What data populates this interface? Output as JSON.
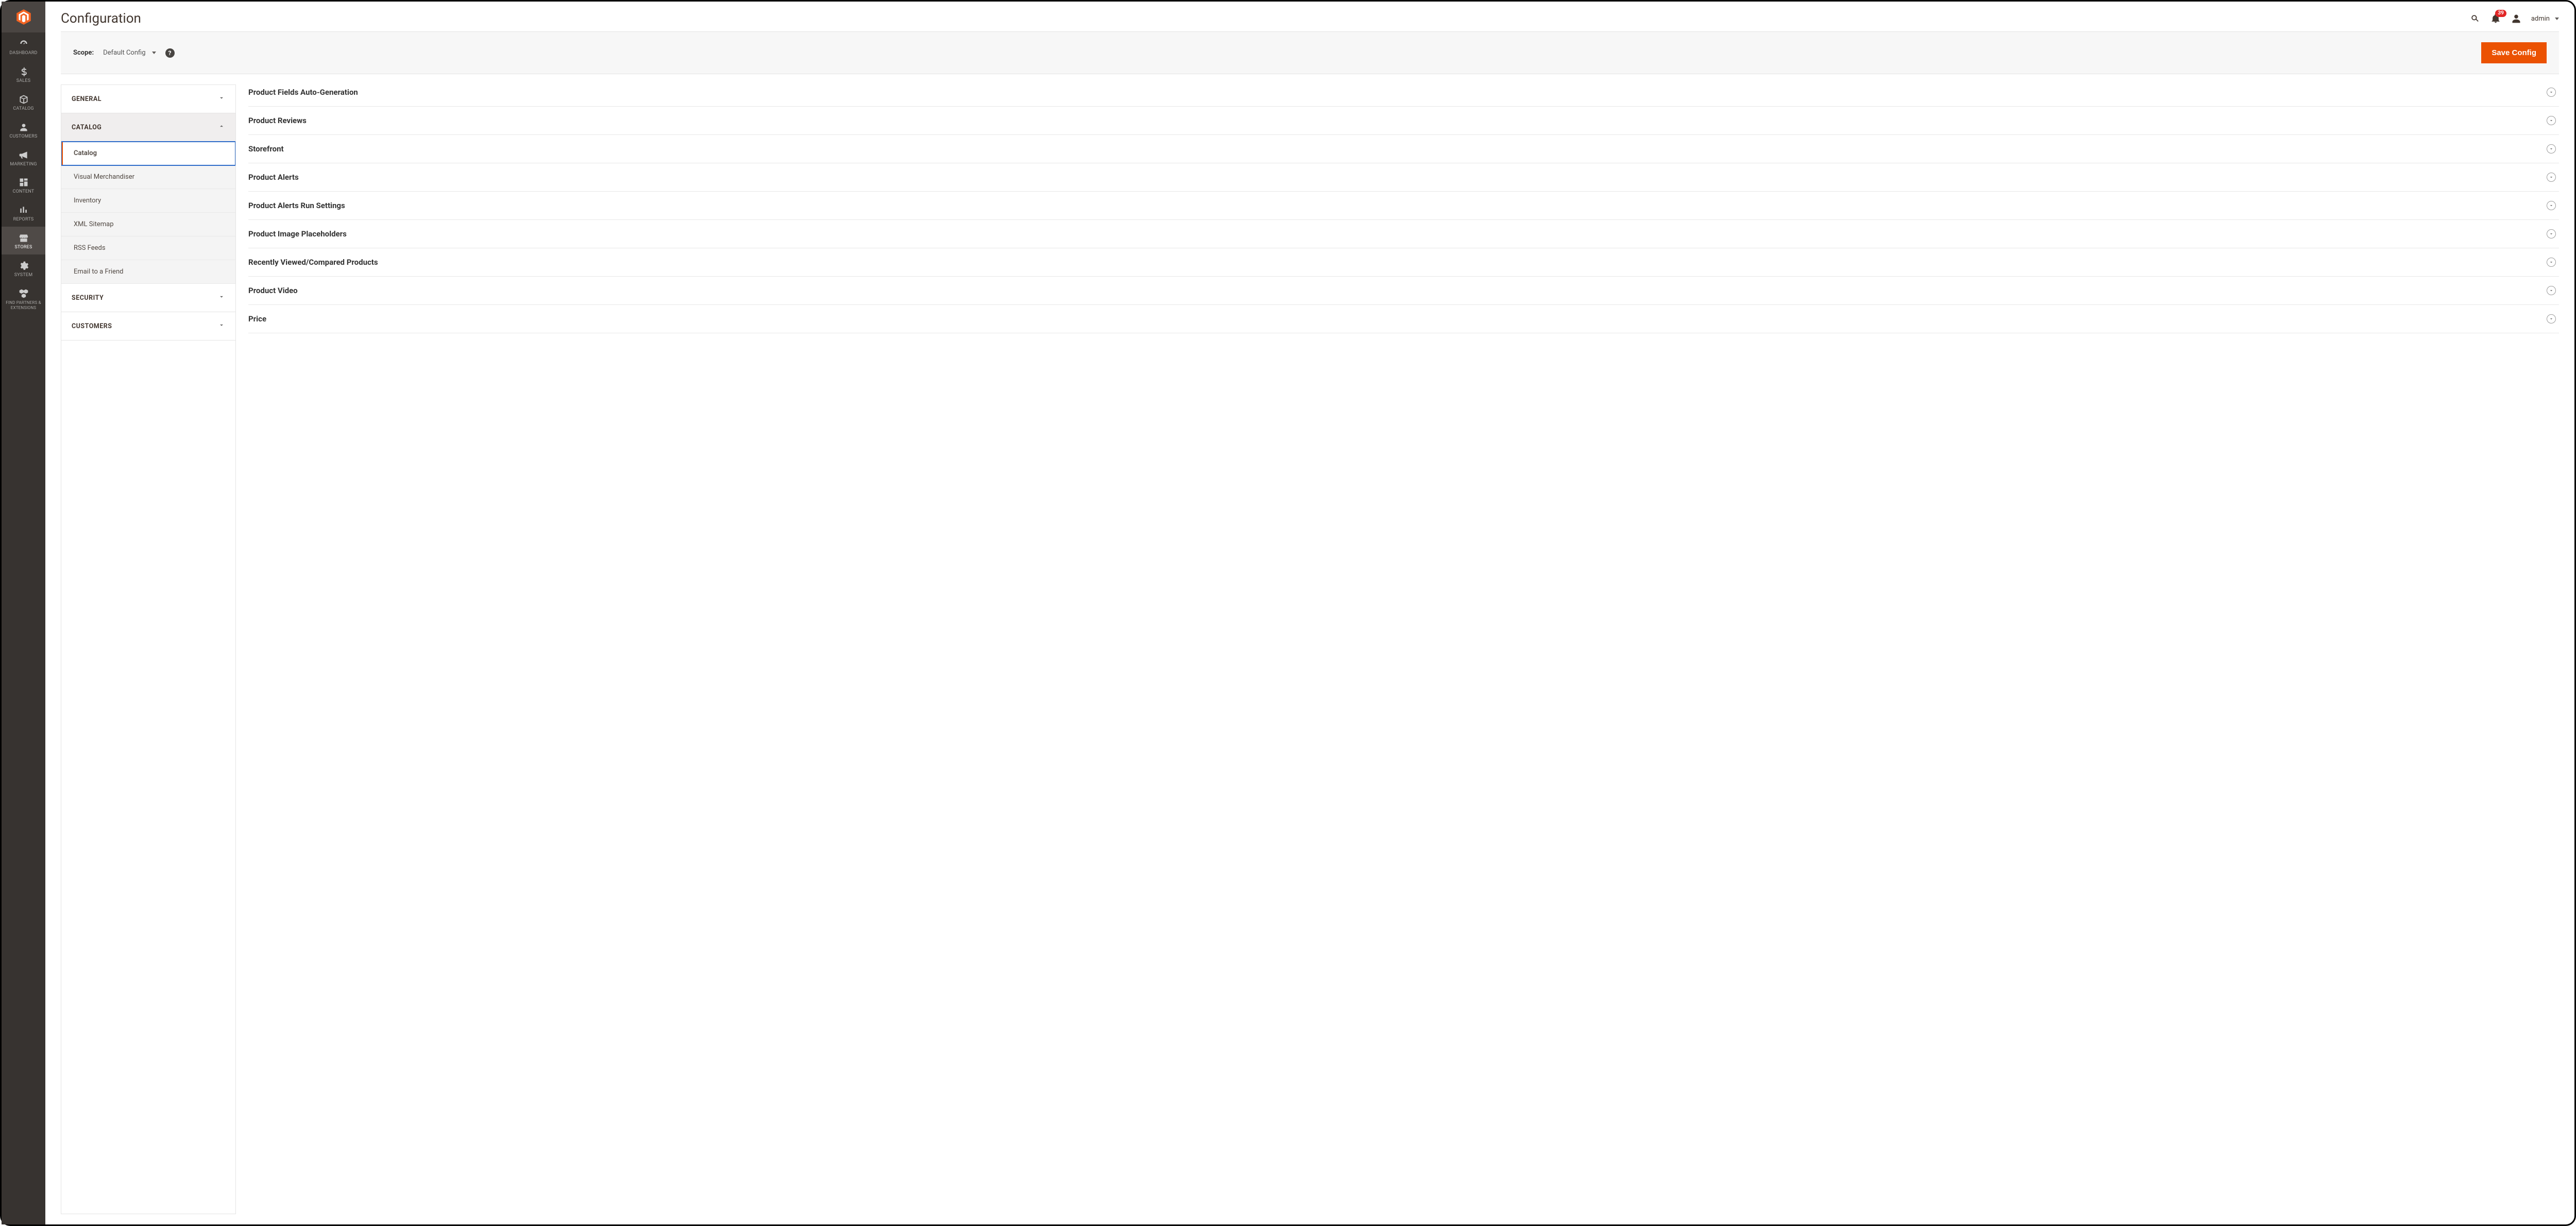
{
  "page_title": "Configuration",
  "notifications_count": "39",
  "account_label": "admin",
  "scope": {
    "label": "Scope:",
    "value": "Default Config"
  },
  "save_label": "Save Config",
  "left_nav": [
    {
      "id": "dashboard",
      "label": "DASHBOARD",
      "icon": "dashboard"
    },
    {
      "id": "sales",
      "label": "SALES",
      "icon": "dollar"
    },
    {
      "id": "catalog",
      "label": "CATALOG",
      "icon": "box"
    },
    {
      "id": "customers",
      "label": "CUSTOMERS",
      "icon": "person"
    },
    {
      "id": "marketing",
      "label": "MARKETING",
      "icon": "megaphone"
    },
    {
      "id": "content",
      "label": "CONTENT",
      "icon": "blocks"
    },
    {
      "id": "reports",
      "label": "REPORTS",
      "icon": "bars"
    },
    {
      "id": "stores",
      "label": "STORES",
      "icon": "storefront",
      "active": true
    },
    {
      "id": "system",
      "label": "SYSTEM",
      "icon": "gear"
    },
    {
      "id": "partners",
      "label": "FIND PARTNERS & EXTENSIONS",
      "icon": "boxes"
    }
  ],
  "config_groups": [
    {
      "id": "general",
      "label": "GENERAL",
      "open": false
    },
    {
      "id": "catalog",
      "label": "CATALOG",
      "open": true,
      "items": [
        {
          "id": "catalog",
          "label": "Catalog",
          "active": true
        },
        {
          "id": "visual-merch",
          "label": "Visual Merchandiser"
        },
        {
          "id": "inventory",
          "label": "Inventory"
        },
        {
          "id": "xml-sitemap",
          "label": "XML Sitemap"
        },
        {
          "id": "rss",
          "label": "RSS Feeds"
        },
        {
          "id": "email-friend",
          "label": "Email to a Friend"
        }
      ]
    },
    {
      "id": "security",
      "label": "SECURITY",
      "open": false
    },
    {
      "id": "customers",
      "label": "CUSTOMERS",
      "open": false
    }
  ],
  "config_sections": [
    {
      "label": "Product Fields Auto-Generation"
    },
    {
      "label": "Product Reviews"
    },
    {
      "label": "Storefront"
    },
    {
      "label": "Product Alerts"
    },
    {
      "label": "Product Alerts Run Settings"
    },
    {
      "label": "Product Image Placeholders"
    },
    {
      "label": "Recently Viewed/Compared Products"
    },
    {
      "label": "Product Video"
    },
    {
      "label": "Price"
    }
  ]
}
